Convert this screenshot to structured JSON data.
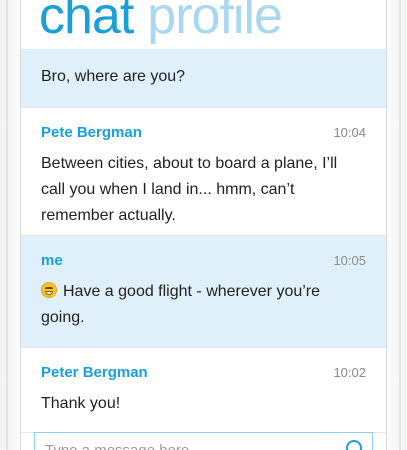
{
  "pivot": {
    "tabs": [
      {
        "label": "chat"
      },
      {
        "label": "profile"
      }
    ]
  },
  "messages": [
    {
      "text": "Bro, where are you?"
    },
    {
      "sender": "Pete Bergman",
      "time": "10:04",
      "text": "Between cities, about to board a plane, I’ll call you when I land in... hmm, can’t remember actually."
    },
    {
      "sender": "me",
      "time": "10:05",
      "text": "Have a good flight - wherever you’re going.",
      "emoji": "grinning-face-emoji"
    },
    {
      "sender": "Peter Bergman",
      "time": "10:02",
      "text": "Thank you!"
    }
  ],
  "composer": {
    "placeholder": "Type a message here",
    "icon": "smiley-icon"
  },
  "colors": {
    "accent": "#1a9fd9",
    "accent_light": "#a8d8f0",
    "outgoing_bg": "#dff0fa"
  }
}
